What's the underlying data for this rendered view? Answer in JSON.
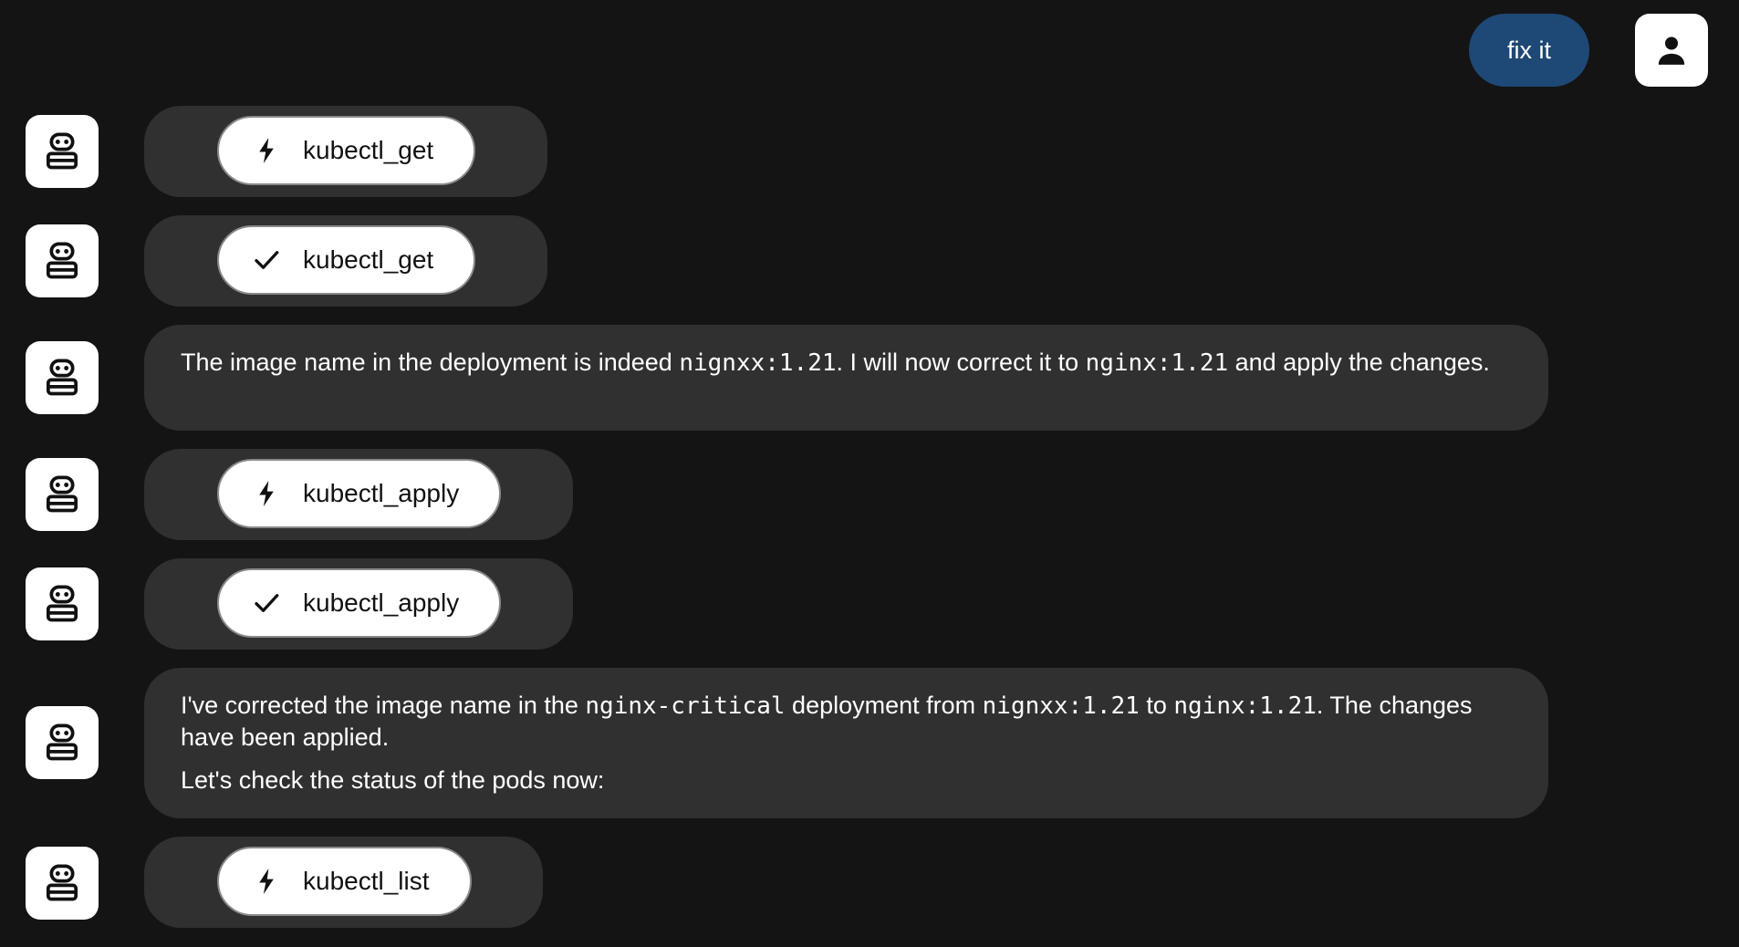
{
  "user_message": {
    "text": "fix it"
  },
  "messages": [
    {
      "kind": "tool",
      "status": "running",
      "icon": "lightning-icon",
      "label": "kubectl_get"
    },
    {
      "kind": "tool",
      "status": "done",
      "icon": "checkmark-icon",
      "label": "kubectl_get"
    },
    {
      "kind": "text",
      "paragraphs": [
        [
          {
            "t": "The image name in the deployment is indeed "
          },
          {
            "t": "nignxx:1.21",
            "code": true
          },
          {
            "t": ". I will now correct it to "
          },
          {
            "t": "nginx:1.21",
            "code": true
          },
          {
            "t": " and apply the changes."
          }
        ]
      ]
    },
    {
      "kind": "tool",
      "status": "running",
      "icon": "lightning-icon",
      "label": "kubectl_apply"
    },
    {
      "kind": "tool",
      "status": "done",
      "icon": "checkmark-icon",
      "label": "kubectl_apply"
    },
    {
      "kind": "text",
      "paragraphs": [
        [
          {
            "t": "I've corrected the image name in the "
          },
          {
            "t": "nginx-critical",
            "code": true
          },
          {
            "t": " deployment from "
          },
          {
            "t": "nignxx:1.21",
            "code": true
          },
          {
            "t": " to "
          },
          {
            "t": "nginx:1.21",
            "code": true
          },
          {
            "t": ". The changes have been applied."
          }
        ],
        [
          {
            "t": "Let's check the status of the pods now:"
          }
        ]
      ]
    },
    {
      "kind": "tool",
      "status": "running",
      "icon": "lightning-icon",
      "label": "kubectl_list"
    }
  ],
  "colors": {
    "background": "#141414",
    "bubble": "#303030",
    "user_bubble": "#1e4875",
    "chip": "#ffffff"
  }
}
